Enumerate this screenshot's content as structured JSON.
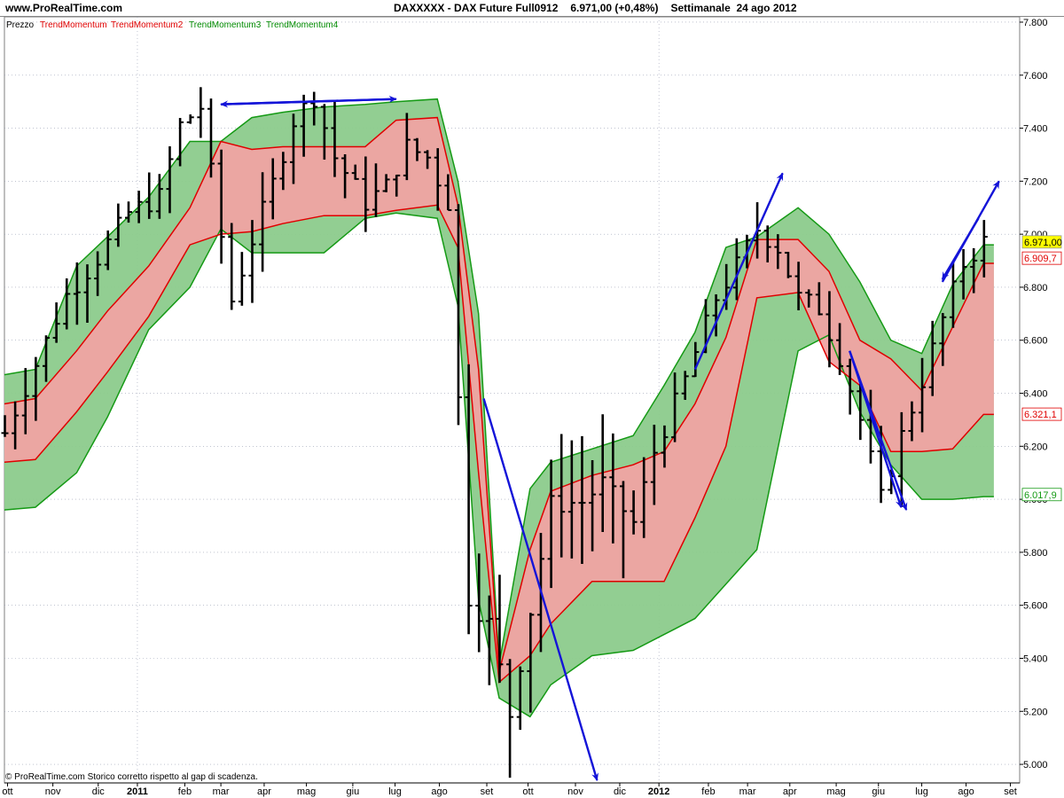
{
  "header": {
    "site": "www.ProRealTime.com",
    "instrument": "DAXXXXX - DAX Future Full0912",
    "quote": "6.971,00 (+0,48%)",
    "period": "Settimanale  24 ago 2012"
  },
  "legend": [
    {
      "label": "Prezzo",
      "color": "#000000"
    },
    {
      "label": "TrendMomentum",
      "color": "#e00000"
    },
    {
      "label": "TrendMomentum2",
      "color": "#e00000"
    },
    {
      "label": "TrendMomentum3",
      "color": "#008a00"
    },
    {
      "label": "TrendMomentum4",
      "color": "#008a00"
    }
  ],
  "footer": "© ProRealTime.com  Storico corretto rispetto al gap di scadenza.",
  "colors": {
    "red_fill": "#f0a3a3",
    "green_fill": "#8ccb8c",
    "red_line": "#e00000",
    "green_line": "#159a15",
    "arrow": "#1414d8",
    "price": "#000000",
    "grid": "#9aa0b4",
    "badge_price": "#ffff00"
  },
  "chart_data": {
    "type": "ohlc",
    "title": "DAXXXXX - DAX Future Full0912",
    "ylim": [
      4930,
      7820
    ],
    "y_ticks": [
      5000,
      5200,
      5400,
      5600,
      5800,
      6000,
      6200,
      6400,
      6600,
      6800,
      7000,
      7200,
      7400,
      7600,
      7800
    ],
    "y_tick_labels": [
      "5.000",
      "5.200",
      "5.400",
      "5.600",
      "5.800",
      "6.000",
      "6.200",
      "6.400",
      "6.600",
      "6.800",
      "7.000",
      "7.200",
      "7.400",
      "7.600",
      "7.800"
    ],
    "x_ticks": [
      {
        "label": "ott",
        "week": 0.3,
        "bold": false
      },
      {
        "label": "nov",
        "week": 4.7,
        "bold": false
      },
      {
        "label": "dic",
        "week": 9.1,
        "bold": false
      },
      {
        "label": "2011",
        "week": 12.9,
        "bold": true
      },
      {
        "label": "feb",
        "week": 17.5,
        "bold": false
      },
      {
        "label": "mar",
        "week": 21.0,
        "bold": false
      },
      {
        "label": "apr",
        "week": 25.2,
        "bold": false
      },
      {
        "label": "mag",
        "week": 29.3,
        "bold": false
      },
      {
        "label": "giu",
        "week": 33.8,
        "bold": false
      },
      {
        "label": "lug",
        "week": 37.9,
        "bold": false
      },
      {
        "label": "ago",
        "week": 42.2,
        "bold": false
      },
      {
        "label": "set",
        "week": 46.8,
        "bold": false
      },
      {
        "label": "ott",
        "week": 50.8,
        "bold": false
      },
      {
        "label": "nov",
        "week": 55.4,
        "bold": false
      },
      {
        "label": "dic",
        "week": 59.7,
        "bold": false
      },
      {
        "label": "2012",
        "week": 63.5,
        "bold": true
      },
      {
        "label": "feb",
        "week": 68.3,
        "bold": false
      },
      {
        "label": "mar",
        "week": 72.1,
        "bold": false
      },
      {
        "label": "apr",
        "week": 76.2,
        "bold": false
      },
      {
        "label": "mag",
        "week": 80.7,
        "bold": false
      },
      {
        "label": "giu",
        "week": 84.8,
        "bold": false
      },
      {
        "label": "lug",
        "week": 89.0,
        "bold": false
      },
      {
        "label": "ago",
        "week": 93.3,
        "bold": false
      },
      {
        "label": "set",
        "week": 97.6,
        "bold": false
      }
    ],
    "grid_weeks": [
      12.9,
      63.5
    ],
    "price_badges": [
      {
        "label": "6.971,00",
        "value": 6971,
        "kind": "price"
      },
      {
        "label": "6.909,7",
        "value": 6909.7,
        "kind": "red"
      },
      {
        "label": "6.321,1",
        "value": 6321.1,
        "kind": "red"
      },
      {
        "label": "6.017,9",
        "value": 6017.9,
        "kind": "green"
      }
    ],
    "bands": {
      "weeks": [
        0,
        3,
        7,
        10,
        14,
        18,
        21,
        24,
        27,
        31,
        35,
        38,
        42,
        44,
        46,
        48,
        51,
        53,
        57,
        61,
        64,
        67,
        70,
        73,
        77,
        80,
        83,
        86,
        89,
        92,
        95
      ],
      "green_upper": [
        6470,
        6490,
        6880,
        6990,
        7140,
        7350,
        7350,
        7440,
        7460,
        7480,
        7490,
        7500,
        7510,
        7200,
        6700,
        5380,
        6040,
        6140,
        6190,
        6240,
        6430,
        6630,
        6950,
        6990,
        7100,
        7000,
        6820,
        6600,
        6550,
        6810,
        6960
      ],
      "red_upper": [
        6360,
        6380,
        6560,
        6710,
        6880,
        7100,
        7350,
        7320,
        7330,
        7330,
        7330,
        7430,
        7440,
        7110,
        6490,
        5350,
        5810,
        6030,
        6090,
        6130,
        6180,
        6360,
        6610,
        6980,
        6980,
        6860,
        6600,
        6530,
        6410,
        6650,
        6890
      ],
      "red_lower": [
        6140,
        6150,
        6330,
        6480,
        6690,
        6960,
        7000,
        7010,
        7040,
        7070,
        7070,
        7090,
        7110,
        6950,
        6100,
        5310,
        5410,
        5530,
        5690,
        5690,
        5690,
        5930,
        6200,
        6760,
        6780,
        6520,
        6430,
        6180,
        6180,
        6190,
        6320
      ],
      "green_lower": [
        5960,
        5970,
        6100,
        6310,
        6640,
        6800,
        7020,
        6930,
        6930,
        6930,
        7060,
        7080,
        7060,
        6730,
        5620,
        5250,
        5180,
        5300,
        5410,
        5430,
        5490,
        5550,
        5680,
        5810,
        6560,
        6620,
        6330,
        6130,
        6000,
        6000,
        6010
      ]
    },
    "arrows": [
      {
        "from": [
          21,
          7490
        ],
        "to": [
          38,
          7510
        ]
      },
      {
        "from": [
          38,
          7510
        ],
        "to": [
          21,
          7490
        ]
      },
      {
        "from": [
          46.5,
          6380
        ],
        "to": [
          57.5,
          4940
        ]
      },
      {
        "from": [
          67,
          6490
        ],
        "to": [
          75.5,
          7230
        ]
      },
      {
        "from": [
          82,
          6560
        ],
        "to": [
          87.5,
          5960
        ]
      },
      {
        "from": [
          82,
          6560
        ],
        "to": [
          87,
          5970
        ]
      },
      {
        "from": [
          91,
          6820
        ],
        "to": [
          96.5,
          7200
        ]
      },
      {
        "from": [
          94.5,
          7060
        ],
        "to": [
          91,
          6830
        ]
      }
    ],
    "price_anchors": {
      "weeks": [
        0,
        3,
        6,
        9,
        12,
        15,
        17,
        19,
        20,
        22,
        24,
        26,
        28,
        30,
        32,
        35,
        37,
        39,
        41,
        43,
        45,
        47,
        49,
        51,
        53,
        56,
        58,
        61,
        63,
        66,
        69,
        71,
        73,
        75,
        77,
        79,
        81,
        83,
        85,
        87,
        89,
        91,
        93,
        95
      ],
      "close": [
        6250,
        6510,
        6770,
        6910,
        7080,
        7140,
        7410,
        7480,
        7230,
        6750,
        6980,
        7190,
        7430,
        7520,
        7290,
        7120,
        7180,
        7330,
        7290,
        7120,
        5630,
        5530,
        5190,
        5580,
        5980,
        5990,
        6060,
        5910,
        6180,
        6450,
        6760,
        6880,
        7020,
        6950,
        6760,
        6720,
        6540,
        6300,
        6000,
        6240,
        6450,
        6680,
        6890,
        6971
      ]
    }
  }
}
